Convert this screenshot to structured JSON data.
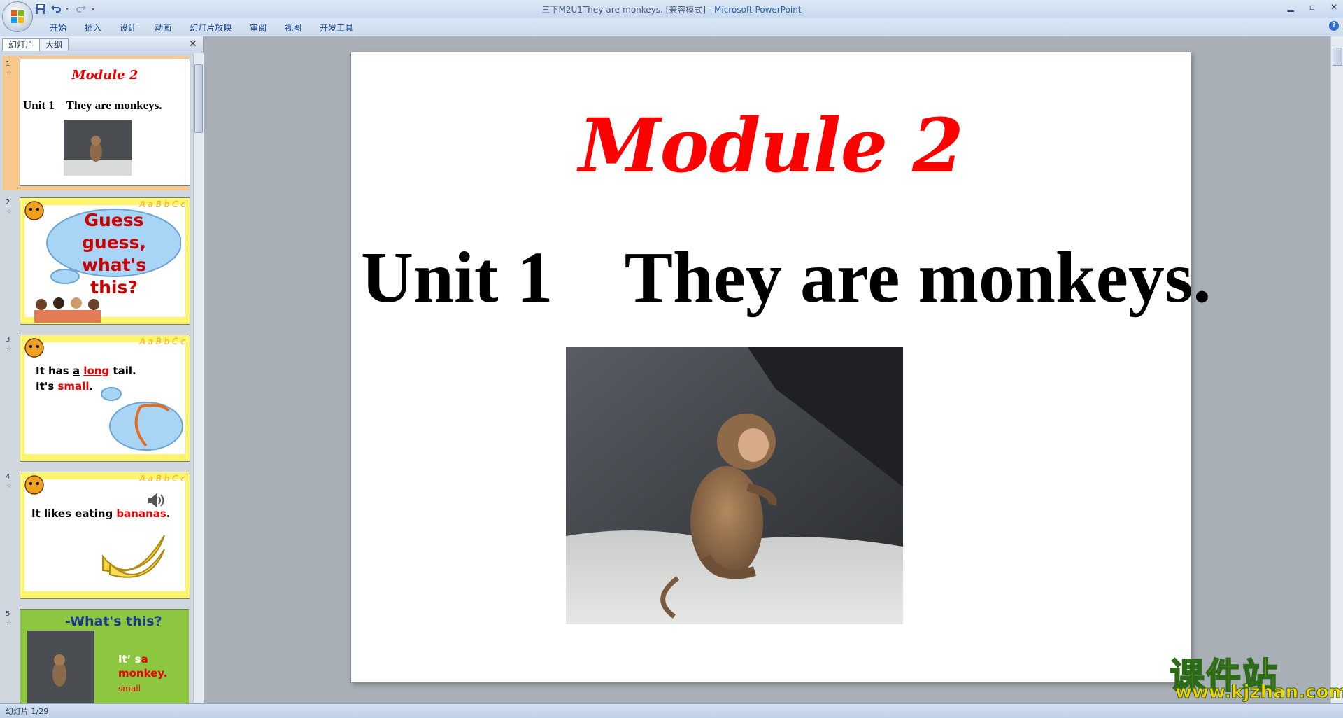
{
  "window": {
    "title": "三下M2U1They-are-monkeys. [兼容模式]",
    "separator": " - ",
    "app_name": "Microsoft PowerPoint",
    "minimize": "▁",
    "maximize": "▫",
    "close": "✕"
  },
  "ribbon": {
    "tabs": [
      "开始",
      "插入",
      "设计",
      "动画",
      "幻灯片放映",
      "审阅",
      "视图",
      "开发工具"
    ]
  },
  "slide_pane": {
    "tabs": {
      "slides": "幻灯片",
      "outline": "大纲"
    },
    "close": "✕",
    "thumbnails": [
      {
        "num": "1",
        "title": "Module 2",
        "subtitle": "Unit 1    They are monkeys."
      },
      {
        "num": "2",
        "text1": "Guess guess,",
        "text2": "what's this?",
        "abc": "A a B b C c"
      },
      {
        "num": "3",
        "line1a": "It has ",
        "line1b": "a",
        "line1c": "long",
        "line1d": "tail.",
        "line2a": "It's ",
        "line2b": "small",
        "line2c": ".",
        "abc": "A a B b C c"
      },
      {
        "num": "4",
        "line1a": "It likes eating ",
        "line1b": "bananas",
        "line1c": ".",
        "abc": "A a B b C c"
      },
      {
        "num": "5",
        "title": "-What's this?",
        "line1": "It’ s",
        "line1b": "a",
        "line2": "monkey.",
        "line3": "small"
      }
    ]
  },
  "slide": {
    "module": "Module 2",
    "unit": "Unit 1    They are monkeys."
  },
  "status_bar": {
    "text": "幻灯片 1/29"
  },
  "watermark": {
    "cn": "课件站",
    "url": "www.kjzhan.com"
  }
}
